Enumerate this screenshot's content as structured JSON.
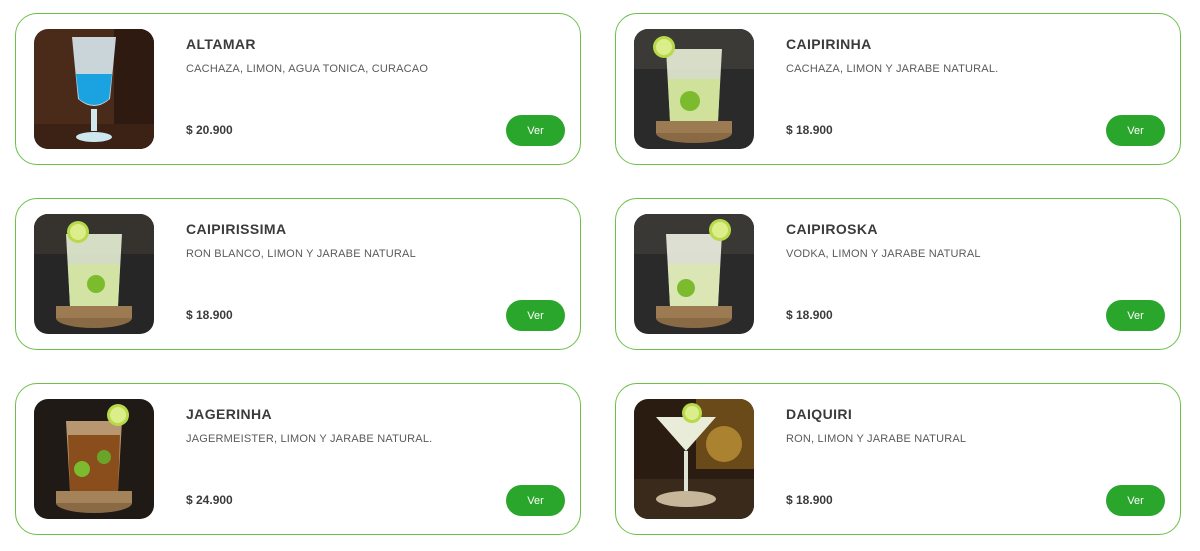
{
  "products": [
    {
      "name": "ALTAMAR",
      "description": "CACHAZA, LIMON, AGUA TONICA, CURACAO",
      "price": "$ 20.900",
      "button": "Ver",
      "image": "blue-cocktail-glass"
    },
    {
      "name": "CAIPIRINHA",
      "description": "CACHAZA, LIMON Y JARABE NATURAL.",
      "price": "$ 18.900",
      "button": "Ver",
      "image": "lime-cocktail-glass"
    },
    {
      "name": "CAIPIRISSIMA",
      "description": "RON BLANCO, LIMON Y JARABE NATURAL",
      "price": "$ 18.900",
      "button": "Ver",
      "image": "lime-cocktail-glass"
    },
    {
      "name": "CAIPIROSKA",
      "description": "VODKA, LIMON Y JARABE NATURAL",
      "price": "$ 18.900",
      "button": "Ver",
      "image": "lime-cocktail-glass"
    },
    {
      "name": "JAGERINHA",
      "description": "JAGERMEISTER, LIMON Y JARABE NATURAL.",
      "price": "$ 24.900",
      "button": "Ver",
      "image": "amber-cocktail-glass"
    },
    {
      "name": "DAIQUIRI",
      "description": "RON, LIMON Y JARABE NATURAL",
      "price": "$ 18.900",
      "button": "Ver",
      "image": "martini-glass"
    }
  ],
  "colors": {
    "accent": "#29a62b",
    "border": "#6cc04a",
    "text": "#3b3b3b"
  }
}
